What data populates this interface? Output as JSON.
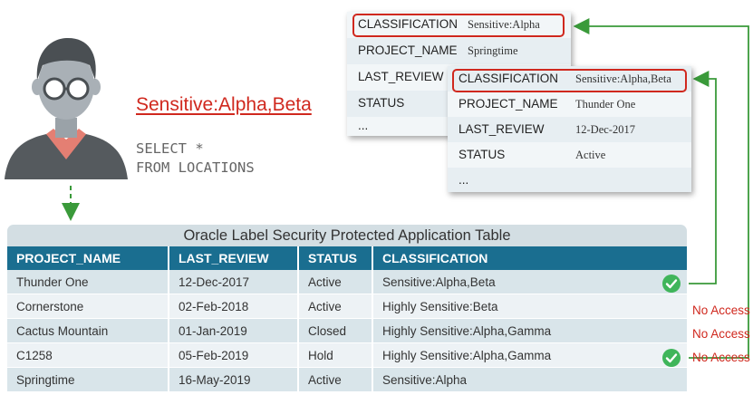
{
  "user": {
    "label_set": "Sensitive:Alpha,Beta",
    "query": "SELECT *\nFROM LOCATIONS"
  },
  "colors": {
    "accent_red": "#d0281e",
    "arrow_green": "#3a9a3a",
    "header_teal": "#1a6e90",
    "check_green": "#3fb55a"
  },
  "card_back": {
    "rows": [
      {
        "key": "CLASSIFICATION",
        "value": "Sensitive:Alpha"
      },
      {
        "key": "PROJECT_NAME",
        "value": "Springtime"
      },
      {
        "key": "LAST_REVIEW",
        "value": ""
      },
      {
        "key": "STATUS",
        "value": ""
      },
      {
        "key": "...",
        "value": ""
      }
    ]
  },
  "card_front": {
    "rows": [
      {
        "key": "CLASSIFICATION",
        "value": "Sensitive:Alpha,Beta"
      },
      {
        "key": "PROJECT_NAME",
        "value": "Thunder One"
      },
      {
        "key": "LAST_REVIEW",
        "value": "12-Dec-2017"
      },
      {
        "key": "STATUS",
        "value": "Active"
      },
      {
        "key": "...",
        "value": ""
      }
    ]
  },
  "table": {
    "caption": "Oracle Label Security Protected Application Table",
    "columns": [
      "PROJECT_NAME",
      "LAST_REVIEW",
      "STATUS",
      "CLASSIFICATION"
    ],
    "rows": [
      {
        "cells": [
          "Thunder One",
          "12-Dec-2017",
          "Active",
          "Sensitive:Alpha,Beta"
        ],
        "access": "granted"
      },
      {
        "cells": [
          "Cornerstone",
          "02-Feb-2018",
          "Active",
          "Highly Sensitive:Beta"
        ],
        "access": "No Access"
      },
      {
        "cells": [
          "Cactus Mountain",
          "01-Jan-2019",
          "Closed",
          "Highly Sensitive:Alpha,Gamma"
        ],
        "access": "No Access"
      },
      {
        "cells": [
          "C1258",
          "05-Feb-2019",
          "Hold",
          "Highly Sensitive:Alpha,Gamma"
        ],
        "access": "No Access"
      },
      {
        "cells": [
          "Springtime",
          "16-May-2019",
          "Active",
          "Sensitive:Alpha"
        ],
        "access": "granted"
      }
    ]
  }
}
